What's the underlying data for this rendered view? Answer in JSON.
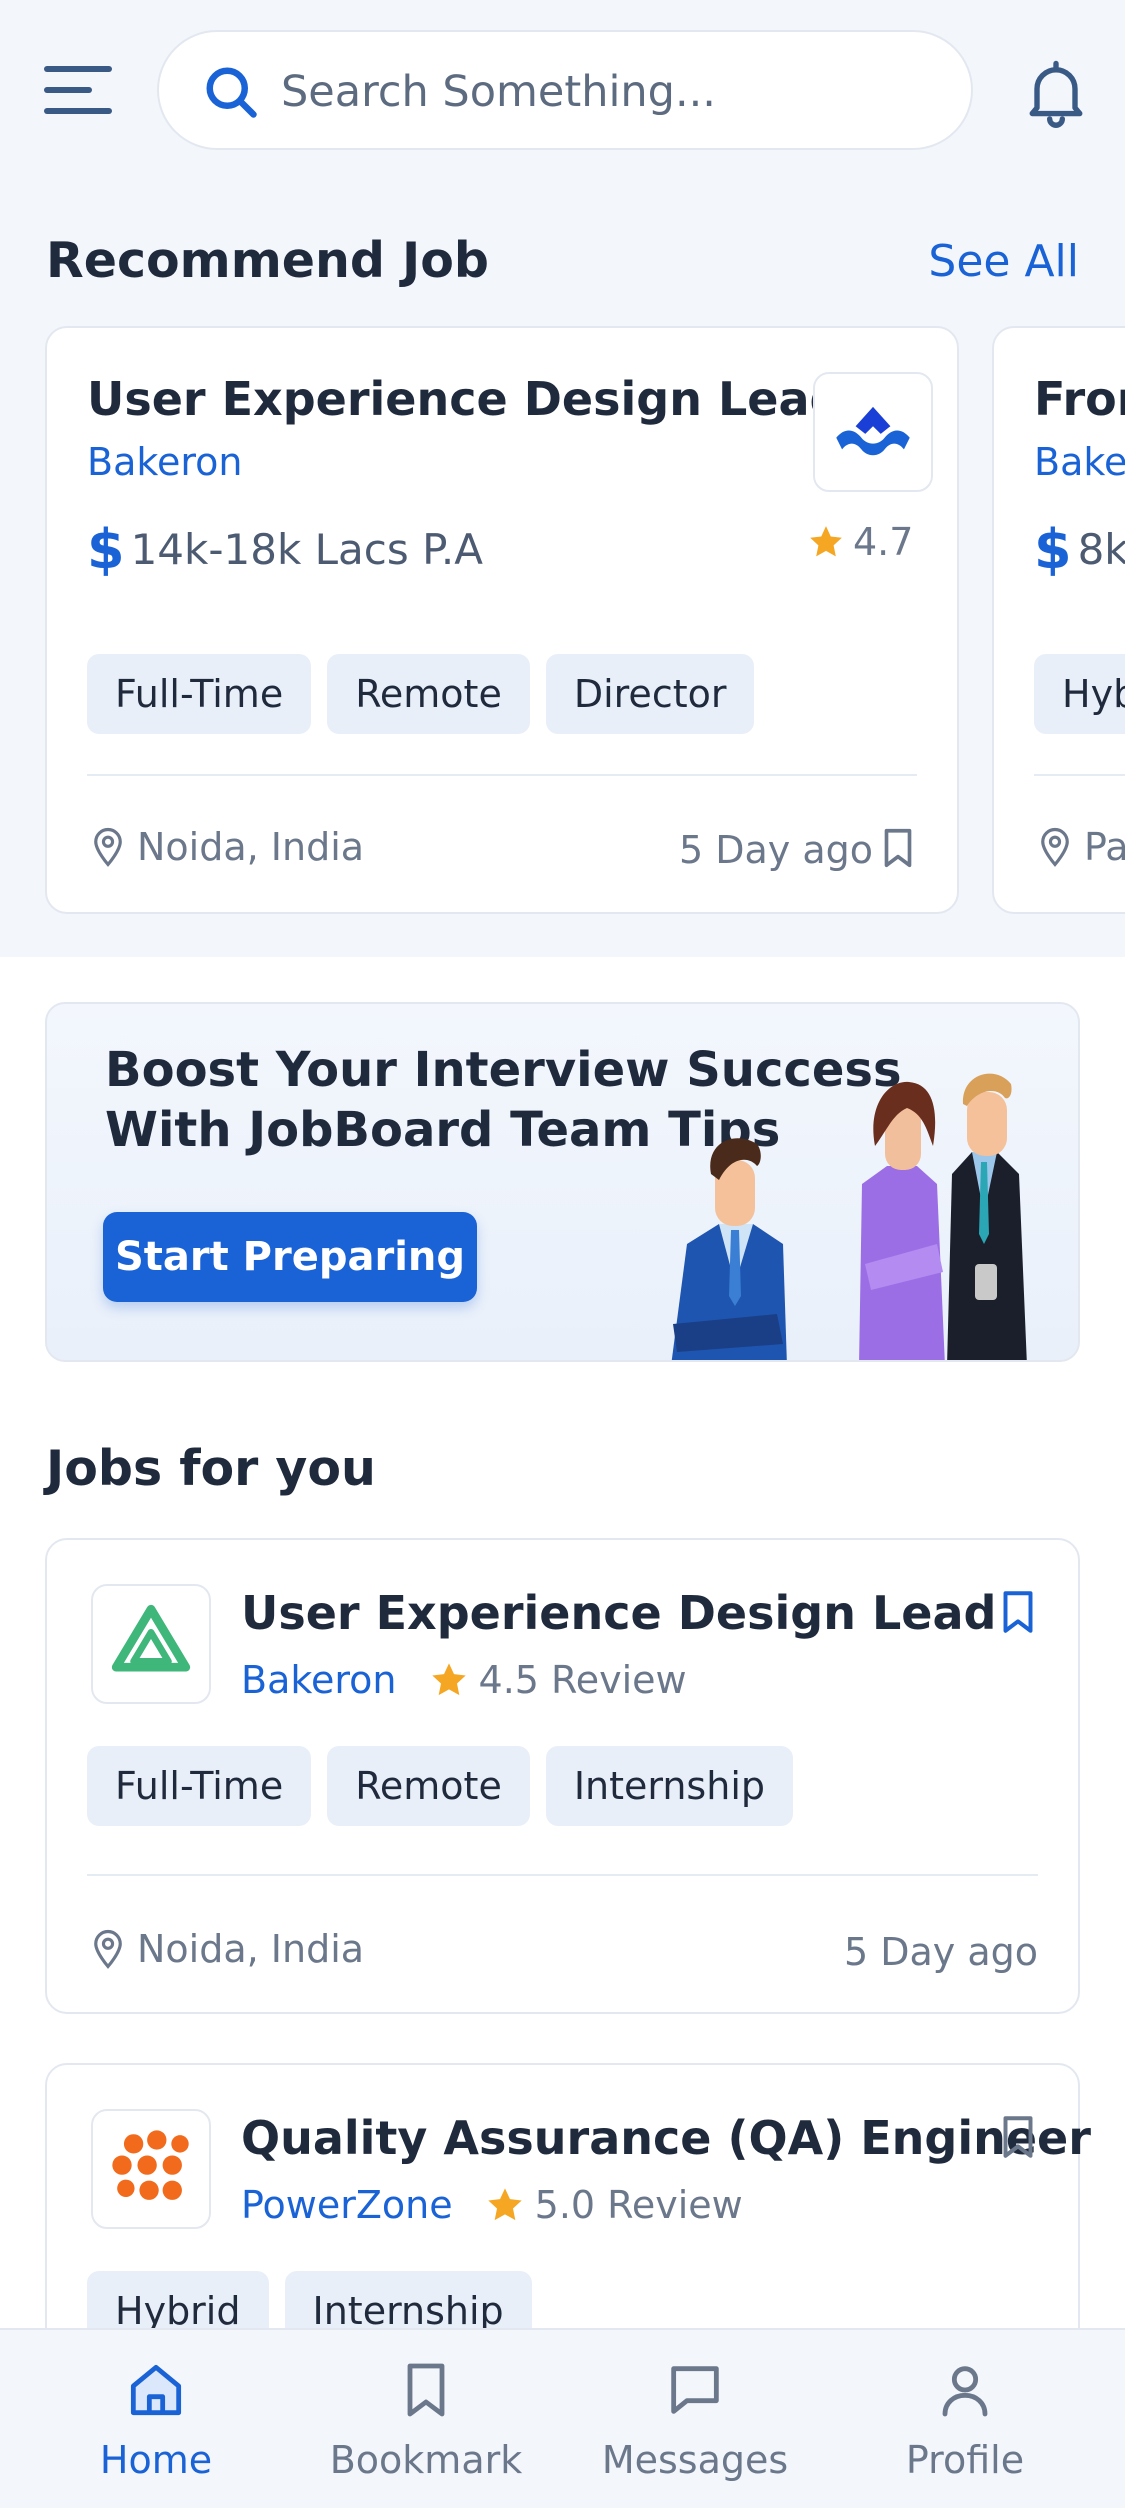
{
  "header": {
    "search_placeholder": "Search Something..."
  },
  "recommend": {
    "title": "Recommend Job",
    "see_all": "See All",
    "cards": [
      {
        "title": "User Experience Design Lead",
        "company": "Bakeron",
        "salary": "14k-18k Lacs P.A",
        "rating": "4.7",
        "tags": [
          "Full-Time",
          "Remote",
          "Director"
        ],
        "location": "Noida, India",
        "posted": "5 Day ago"
      },
      {
        "title": "Fron",
        "company": "Bake",
        "salary": "8k",
        "tags": [
          "Hyb"
        ],
        "location": "Pa"
      }
    ]
  },
  "promo": {
    "title": "Boost Your Interview Success With JobBoard Team Tips",
    "button": "Start Preparing"
  },
  "jobs": {
    "title": "Jobs for you",
    "items": [
      {
        "title": "User Experience Design Lead",
        "company": "Bakeron",
        "review": "4.5 Review",
        "tags": [
          "Full-Time",
          "Remote",
          "Internship"
        ],
        "location": "Noida, India",
        "posted": "5 Day ago"
      },
      {
        "title": "Quality Assurance (QA) Engineer",
        "company": "PowerZone",
        "review": "5.0 Review",
        "tags": [
          "Hybrid",
          "Internship"
        ]
      }
    ]
  },
  "nav": {
    "items": [
      "Home",
      "Bookmark",
      "Messages",
      "Profile"
    ],
    "active": "Home"
  },
  "colors": {
    "accent": "#1a63d6",
    "star": "#f5a623",
    "background": "#f3f6fb"
  }
}
